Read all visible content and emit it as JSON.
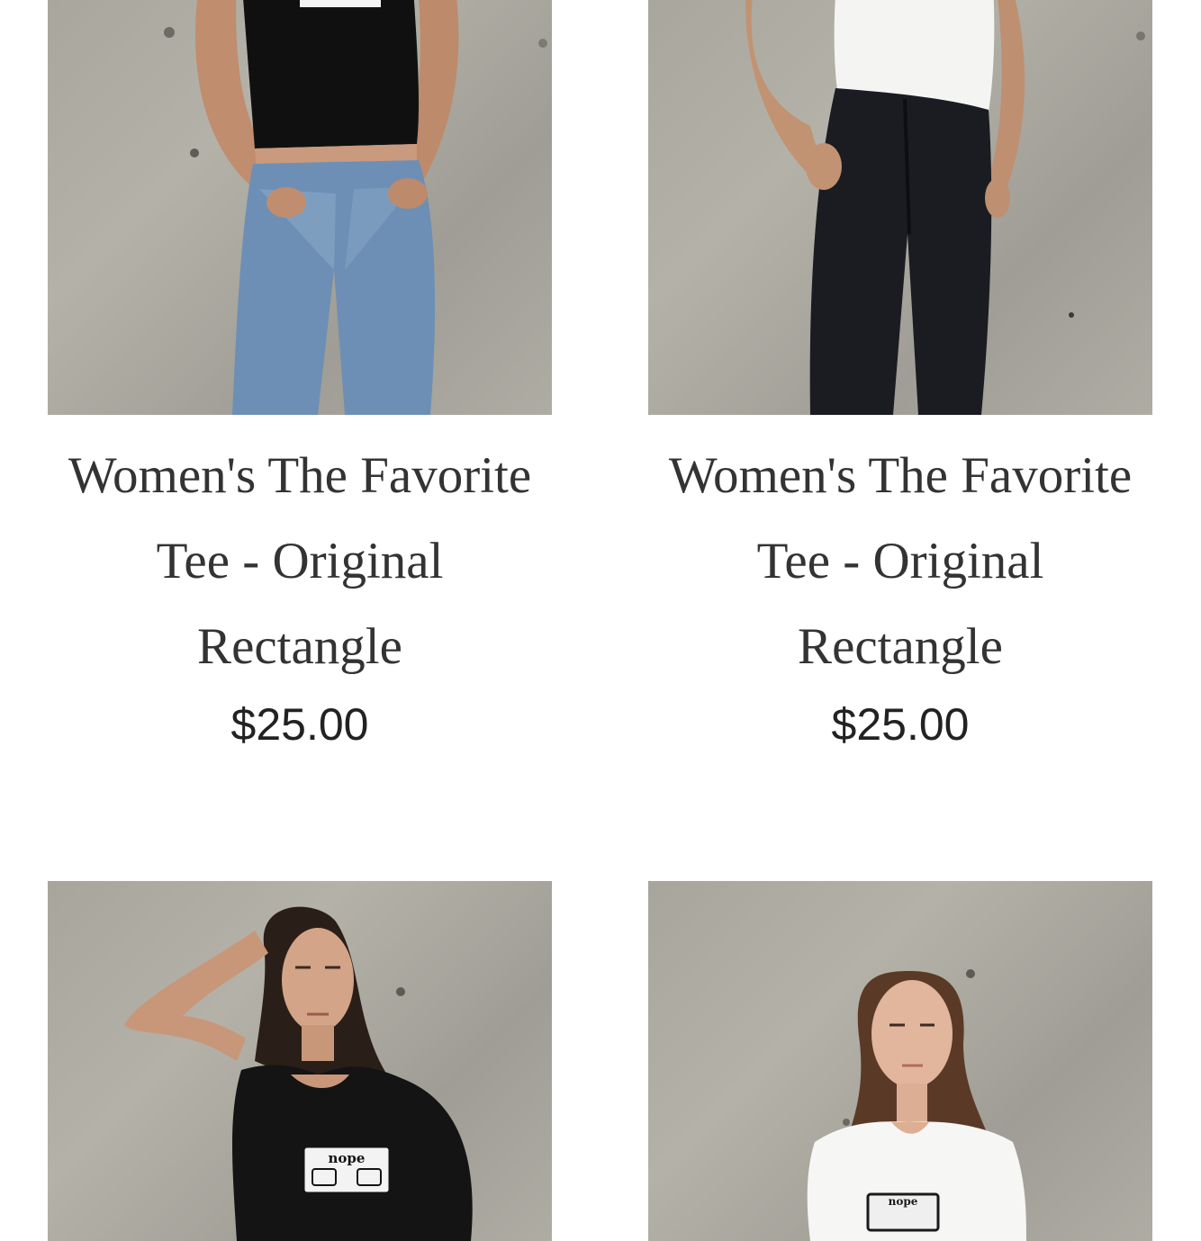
{
  "products": [
    {
      "title": "Women's The Favorite Tee - Original Rectangle",
      "price": "$25.00"
    },
    {
      "title": "Women's The Favorite Tee - Original Rectangle",
      "price": "$25.00"
    },
    {
      "logo_text": "nope"
    },
    {
      "logo_text": "nope"
    }
  ],
  "colors": {
    "background": "#ffffff",
    "title_text": "#333333",
    "price_text": "#222222",
    "wall": "#a7a59c"
  }
}
